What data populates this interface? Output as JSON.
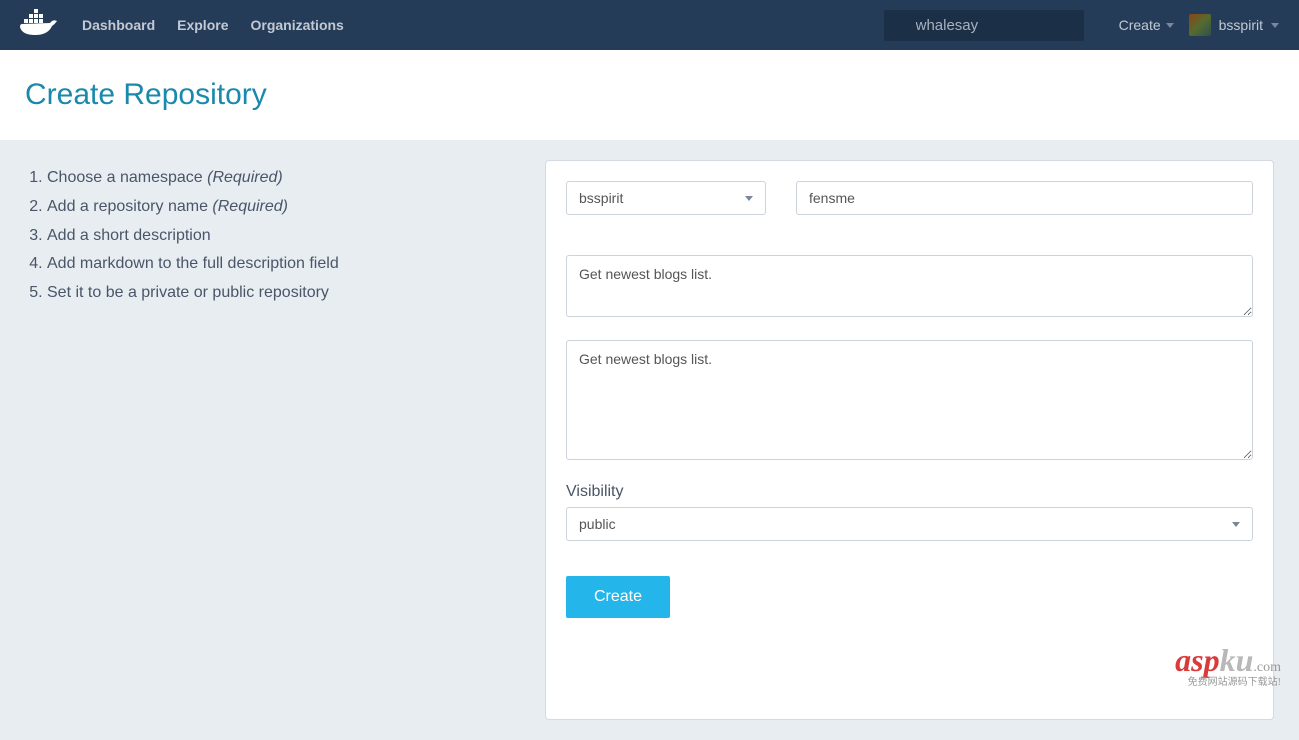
{
  "navbar": {
    "links": [
      "Dashboard",
      "Explore",
      "Organizations"
    ],
    "search_value": "whalesay",
    "create_label": "Create",
    "username": "bsspirit"
  },
  "page": {
    "title": "Create Repository"
  },
  "steps": [
    {
      "text": "Choose a namespace ",
      "required": "(Required)"
    },
    {
      "text": "Add a repository name ",
      "required": "(Required)"
    },
    {
      "text": "Add a short description",
      "required": ""
    },
    {
      "text": "Add markdown to the full description field",
      "required": ""
    },
    {
      "text": "Set it to be a private or public repository",
      "required": ""
    }
  ],
  "form": {
    "namespace_value": "bsspirit",
    "repo_name_value": "fensme",
    "short_desc_value": "Get newest blogs list.",
    "full_desc_value": "Get newest blogs list.",
    "visibility_label": "Visibility",
    "visibility_value": "public",
    "submit_label": "Create"
  },
  "watermark": {
    "part1": "asp",
    "part2": "ku",
    "part3": ".com",
    "sub": "免费网站源码下载站!"
  }
}
